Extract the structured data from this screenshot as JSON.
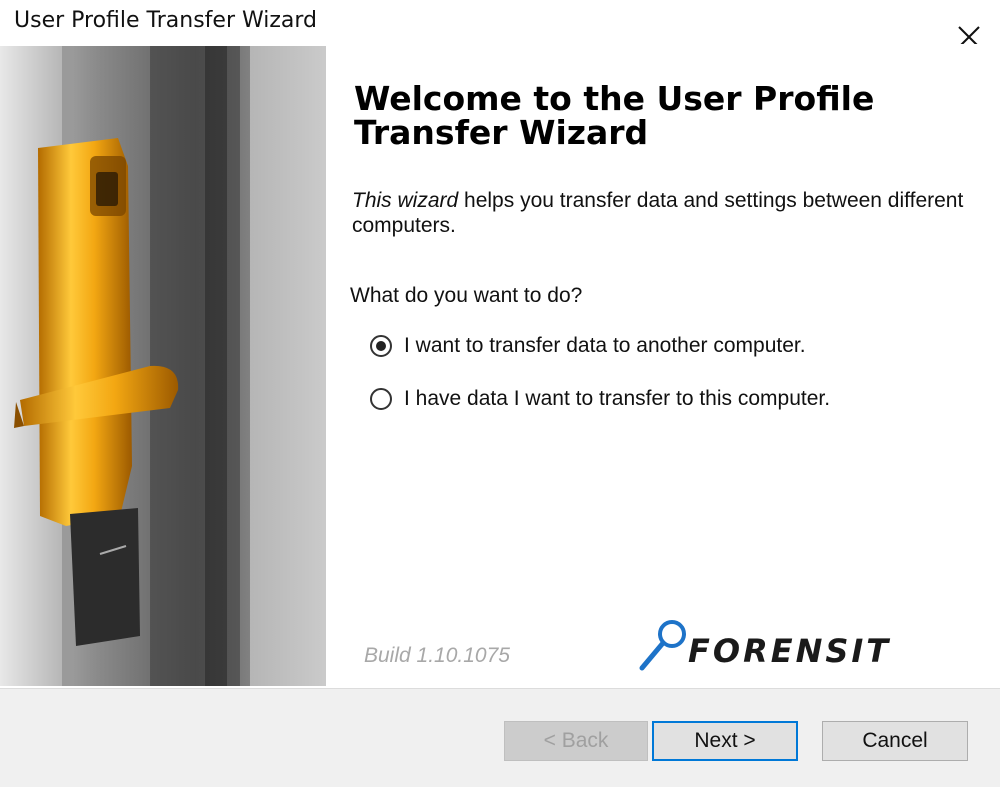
{
  "window": {
    "title": "User Profile Transfer Wizard",
    "close_icon": "close-icon"
  },
  "main": {
    "heading": "Welcome to the User Profile Transfer Wizard",
    "description_lead": "This wizard",
    "description_rest": " helps you transfer data and settings between different computers.",
    "question": "What do you want to do?",
    "options": [
      {
        "label": "I want to transfer data to another computer.",
        "selected": true
      },
      {
        "label": "I have data I want to transfer to this computer.",
        "selected": false
      }
    ],
    "build": "Build 1.10.1075",
    "brand": "FORENSIT",
    "brand_icon": "magnifier-icon"
  },
  "footer": {
    "back_label": "< Back",
    "next_label": "Next >",
    "cancel_label": "Cancel"
  },
  "colors": {
    "accent": "#0078d7",
    "brand_blue": "#1e73c8",
    "door_gold": "#e0a020"
  }
}
